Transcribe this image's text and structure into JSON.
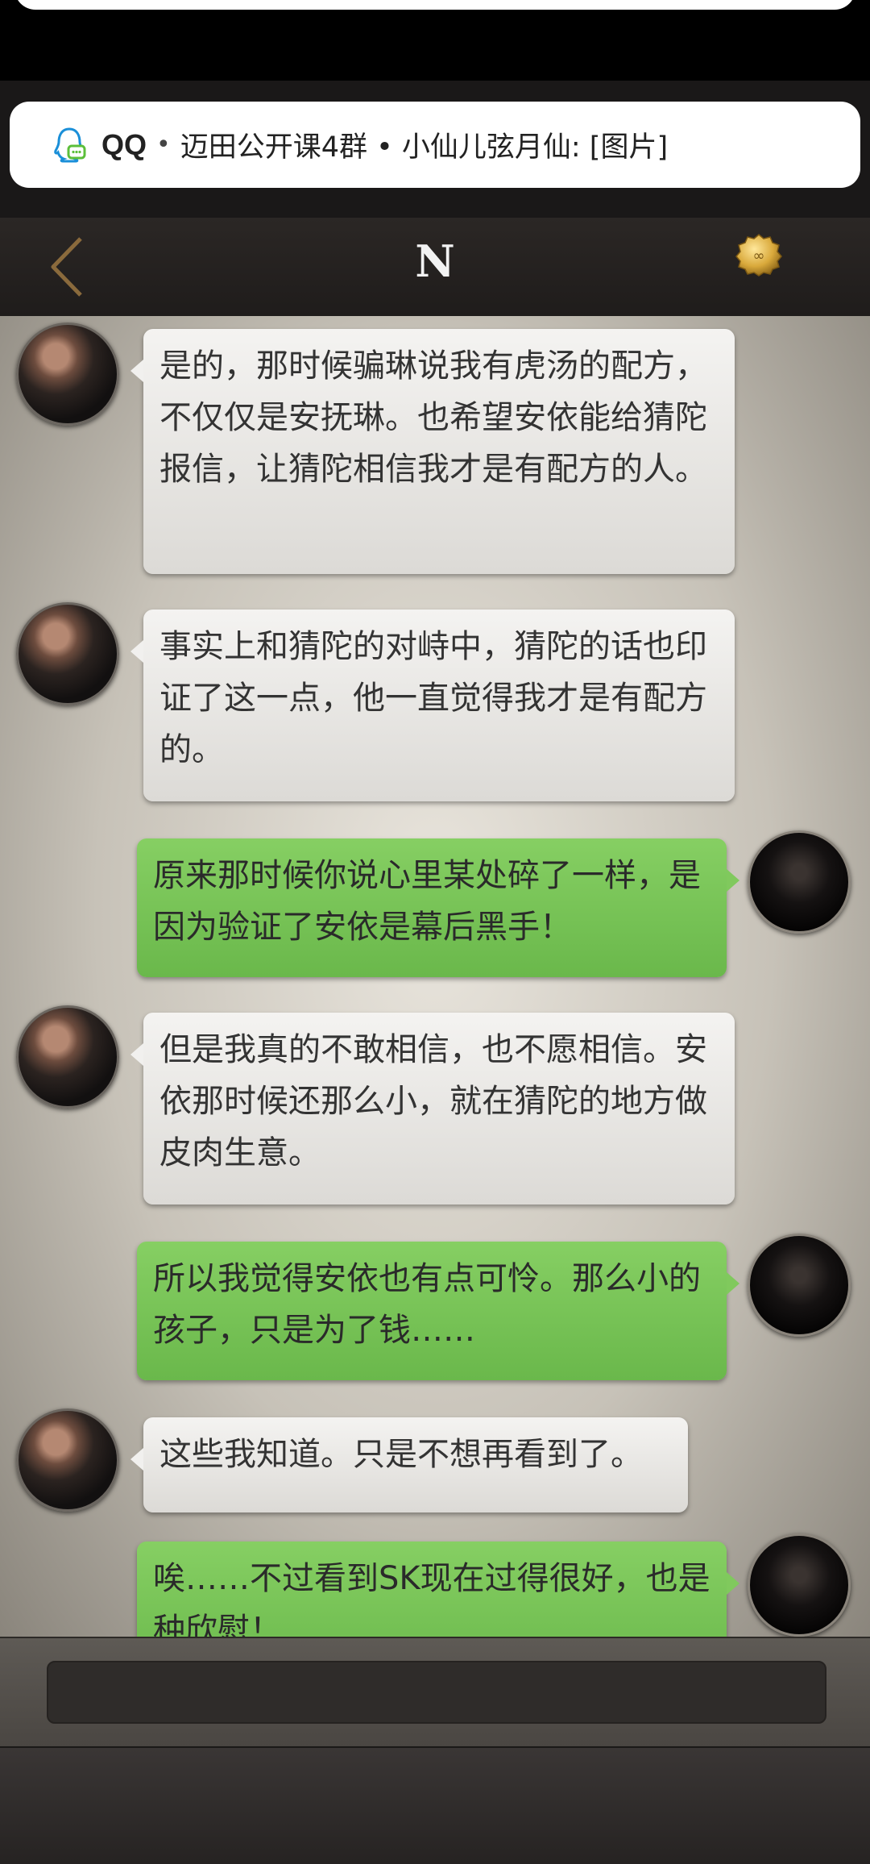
{
  "notification": {
    "icon": "qq-penguin-icon",
    "app": "QQ",
    "separator": "•",
    "text": "迈田公开课4群 • 小仙儿弦月仙: [图片]"
  },
  "header": {
    "title": "N",
    "back_icon": "back-chevron-icon",
    "coin_icon": "gold-coin-icon"
  },
  "messages": [
    {
      "side": "left",
      "text": "是的，那时候骗琳说我有虎汤的配方，不仅仅是安抚琳。也希望安依能给猜陀报信，让猜陀相信我才是有配方的人。"
    },
    {
      "side": "left",
      "text": "事实上和猜陀的对峙中，猜陀的话也印证了这一点，他一直觉得我才是有配方的。"
    },
    {
      "side": "right",
      "text": "原来那时候你说心里某处碎了一样，是因为验证了安依是幕后黑手！"
    },
    {
      "side": "left",
      "text": "但是我真的不敢相信，也不愿相信。安依那时候还那么小，就在猜陀的地方做皮肉生意。"
    },
    {
      "side": "right",
      "text": "所以我觉得安依也有点可怜。那么小的孩子，只是为了钱……"
    },
    {
      "side": "left",
      "text": "这些我知道。只是不想再看到了。"
    },
    {
      "side": "right",
      "text": "唉……不过看到SK现在过得很好，也是种欣慰！"
    }
  ],
  "colors": {
    "left_bubble": "#f1f0ee",
    "right_bubble": "#80c95d",
    "header_bg": "#2b2725",
    "back_icon": "#8a6a3c",
    "coin": "#d9a93b"
  }
}
